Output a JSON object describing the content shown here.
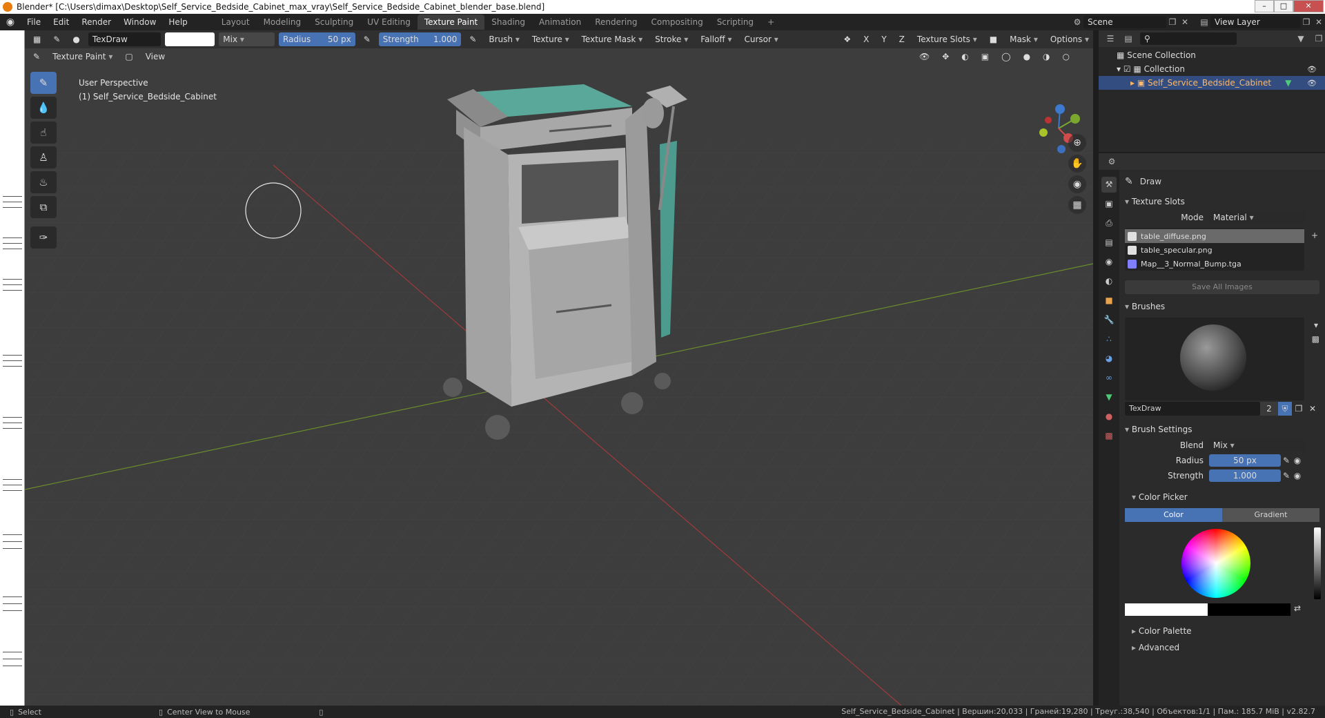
{
  "window": {
    "title": "Blender* [C:\\Users\\dimax\\Desktop\\Self_Service_Bedside_Cabinet_max_vray\\Self_Service_Bedside_Cabinet_blender_base.blend]",
    "min": "–",
    "max": "□",
    "close": "✕"
  },
  "menu": [
    "File",
    "Edit",
    "Render",
    "Window",
    "Help"
  ],
  "workspaces": [
    "Layout",
    "Modeling",
    "Sculpting",
    "UV Editing",
    "Texture Paint",
    "Shading",
    "Animation",
    "Rendering",
    "Compositing",
    "Scripting"
  ],
  "workspace_add": "+",
  "scene": {
    "label": "Scene",
    "view_layer": "View Layer"
  },
  "tool_header": {
    "brush_name": "TexDraw",
    "blend": "Mix",
    "radius_label": "Radius",
    "radius_value": "50 px",
    "strength_label": "Strength",
    "strength_value": "1.000",
    "menus": [
      "Brush",
      "Texture",
      "Texture Mask",
      "Stroke",
      "Falloff",
      "Cursor"
    ],
    "axes": [
      "X",
      "Y",
      "Z"
    ],
    "texture_slots": "Texture Slots",
    "mask": "Mask",
    "options": "Options"
  },
  "mode_header": {
    "mode": "Texture Paint",
    "view": "View"
  },
  "viewport": {
    "perspective": "User Perspective",
    "object": "(1) Self_Service_Bedside_Cabinet",
    "gizmo": {
      "x": "X",
      "y": "Y",
      "z": "Z"
    }
  },
  "outliner": {
    "scene_collection": "Scene Collection",
    "collection": "Collection",
    "object": "Self_Service_Bedside_Cabinet"
  },
  "properties": {
    "tool_name": "Draw",
    "texture_slots": {
      "title": "Texture Slots",
      "mode_label": "Mode",
      "mode_value": "Material",
      "slots": [
        {
          "name": "table_diffuse.png",
          "color": "#e0e0e0"
        },
        {
          "name": "table_specular.png",
          "color": "#e0e0e0"
        },
        {
          "name": "Map__3_Normal_Bump.tga",
          "color": "#8080ff"
        }
      ],
      "save_all": "Save All Images"
    },
    "brushes": {
      "title": "Brushes",
      "name": "TexDraw",
      "users": "2"
    },
    "brush_settings": {
      "title": "Brush Settings",
      "blend_label": "Blend",
      "blend_value": "Mix",
      "radius_label": "Radius",
      "radius_value": "50 px",
      "strength_label": "Strength",
      "strength_value": "1.000"
    },
    "color_picker": {
      "title": "Color Picker",
      "tab_color": "Color",
      "tab_gradient": "Gradient"
    },
    "color_palette": "Color Palette",
    "advanced": "Advanced"
  },
  "statusbar": {
    "select": "Select",
    "center": "Center View to Mouse",
    "info": "Self_Service_Bedside_Cabinet | Вершин:20,033 | Граней:19,280 | Треуг.:38,540 | Объектов:1/1 | Пам.: 185.7 MiB | v2.82.7"
  }
}
